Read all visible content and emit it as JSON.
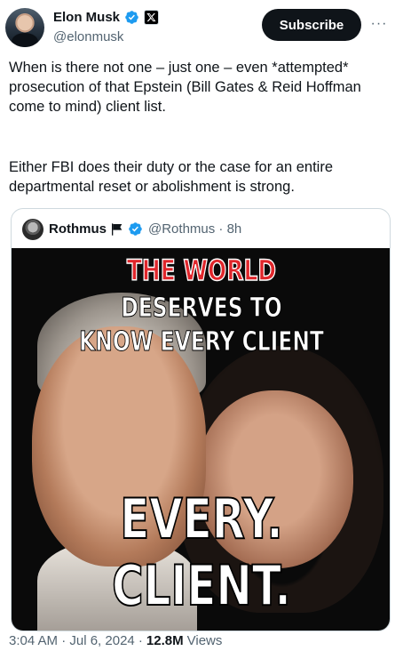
{
  "author": {
    "display_name": "Elon Musk",
    "handle": "@elonmusk",
    "verified_icon": "verified-badge-icon",
    "affiliate_icon": "x-logo-icon"
  },
  "actions": {
    "subscribe_label": "Subscribe",
    "more_label": "···"
  },
  "tweet": {
    "paragraph_1": "When is there not one – just one – even *attempted* prosecution of that Epstein (Bill Gates & Reid Hoffman come to mind) client list.",
    "paragraph_2": "Either FBI does their duty or the case for an entire departmental reset or abolishment is strong."
  },
  "quote": {
    "display_name": "Rothmus",
    "flag_icon": "flag-icon",
    "verified_icon": "verified-badge-icon",
    "handle_time": "@Rothmus · 8h",
    "image": {
      "line_1": "THE WORLD",
      "line_2": "DESERVES TO",
      "line_3": "KNOW EVERY CLIENT",
      "line_4": "EVERY.",
      "line_5": "CLIENT."
    }
  },
  "meta": {
    "timestamp": "3:04 AM · Jul 6, 2024 ·",
    "views_count": "12.8M",
    "views_label": "Views"
  },
  "colors": {
    "text": "#0f1419",
    "secondary": "#536471",
    "verified_blue": "#1d9bf0",
    "border": "#cfd9de",
    "meme_red": "#e0262b"
  }
}
